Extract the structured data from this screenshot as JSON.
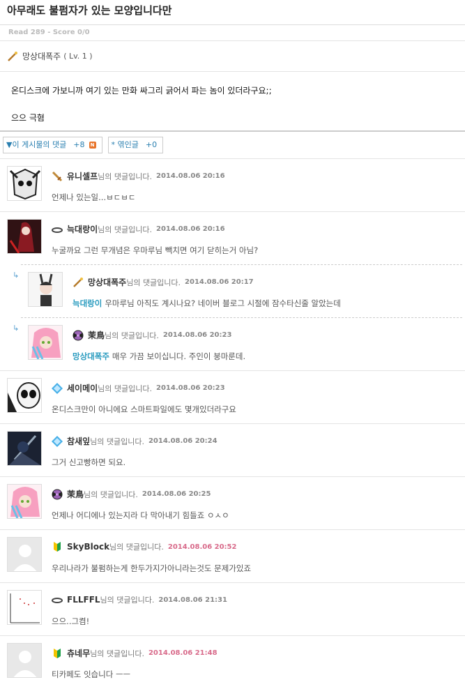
{
  "post": {
    "title": "아무래도 불펌자가 있는 모양입니다만",
    "meta": "Read 289 - Score 0/0",
    "author": "망상대폭주",
    "author_level": "( Lv. 1 )",
    "body_lines": [
      "온디스크에 가보니까 여기 있는 만화 싸그리 긁어서 파는 놈이 있더라구요;;",
      "으으 극혐"
    ]
  },
  "tabs": [
    {
      "label": "▼이 게시물의 댓글",
      "count": "+8"
    },
    {
      "label": "* 엮인글",
      "count": "+0"
    }
  ],
  "comment_suffix": "님의 댓글입니다.",
  "comments": [
    {
      "name": "유니셀프",
      "date": "2014.08.06 20:16",
      "text": "언제나 있는일...ㅂㄷㅂㄷ",
      "badge": "sword-icon"
    },
    {
      "name": "늑대랑이",
      "date": "2014.08.06 20:16",
      "text": "누굴까요 그런 무개념은 우마루님 빽치면 여기 닫히는거 아님?",
      "badge": "halo-icon"
    },
    {
      "name": "망상대폭주",
      "date": "2014.08.06 20:17",
      "to": "늑대랑이",
      "text": "우마루님 아직도 계시나요? 네이버 블로그 시절에 잠수타신줄 알았는데",
      "badge": "wand-icon"
    },
    {
      "name": "茉鳥",
      "date": "2014.08.06 20:23",
      "to": "망상대폭주",
      "text": "매우 가끔 보이십니다. 주인이 붕마룬데.",
      "badge": "radiation-icon"
    },
    {
      "name": "세이메이",
      "date": "2014.08.06 20:23",
      "text": "온디스크만이 아니에요 스마트파일에도 몇개있더라구요",
      "badge": "diamond-icon"
    },
    {
      "name": "참새잎",
      "date": "2014.08.06 20:24",
      "text": "그거 신고빵하면 되요.",
      "badge": "diamond-icon"
    },
    {
      "name": "茉鳥",
      "date": "2014.08.06 20:25",
      "text": "언제나 어디에나 있는지라 다 막아내기 힘들죠 ㅇㅅㅇ",
      "badge": "radiation-icon"
    },
    {
      "name": "SkyBlock",
      "date": "2014.08.06 20:52",
      "text": "우리나라가 불펌하는게 한두가지가아니라는것도 문제가있죠",
      "badge": "beginner-icon"
    },
    {
      "name": "FLLFFL",
      "date": "2014.08.06 21:31",
      "text": "으으..그켬!",
      "badge": "halo-icon"
    },
    {
      "name": "츄네무",
      "date": "2014.08.06 21:48",
      "text": "티카페도 잇습니다 ㅡㅡ",
      "badge": "beginner-icon"
    }
  ]
}
